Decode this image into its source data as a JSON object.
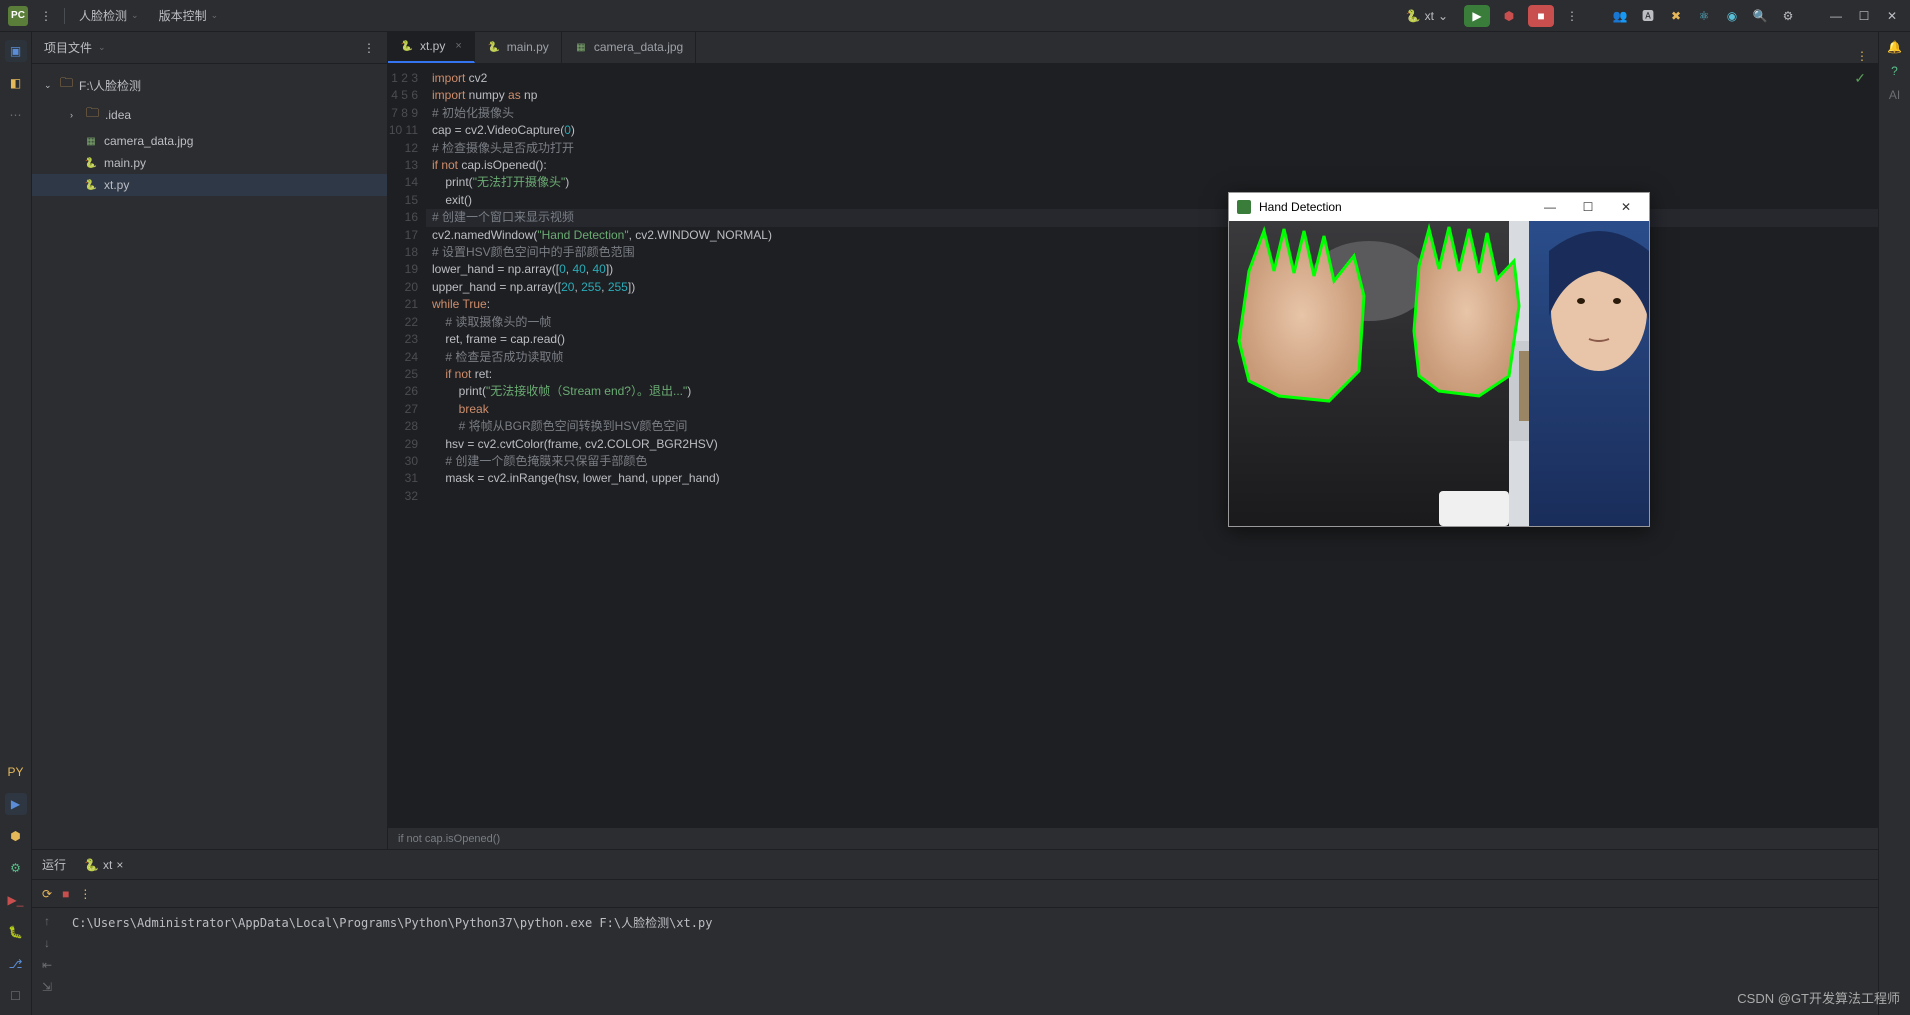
{
  "topbar": {
    "menu1": "人脸检测",
    "menu2": "版本控制",
    "runConfig": "xt"
  },
  "sidebar": {
    "title": "项目文件",
    "root": "F:\\人脸检测",
    "items": [
      {
        "name": ".idea",
        "type": "folder"
      },
      {
        "name": "camera_data.jpg",
        "type": "image"
      },
      {
        "name": "main.py",
        "type": "python"
      },
      {
        "name": "xt.py",
        "type": "python",
        "selected": true
      }
    ]
  },
  "tabs": [
    {
      "name": "xt.py",
      "type": "python",
      "active": true
    },
    {
      "name": "main.py",
      "type": "python"
    },
    {
      "name": "camera_data.jpg",
      "type": "image"
    }
  ],
  "code": {
    "lines": [
      {
        "n": 1,
        "html": "<span class='kw'>import</span> cv2"
      },
      {
        "n": 2,
        "html": "<span class='kw'>import</span> numpy <span class='kw'>as</span> np"
      },
      {
        "n": 3,
        "html": ""
      },
      {
        "n": 4,
        "html": "<span class='com'># 初始化摄像头</span>"
      },
      {
        "n": 5,
        "html": "cap = cv2.VideoCapture(<span class='num'>0</span>)"
      },
      {
        "n": 6,
        "html": ""
      },
      {
        "n": 7,
        "html": "<span class='com'># 检查摄像头是否成功打开</span>"
      },
      {
        "n": 8,
        "html": "<span class='kw'>if not</span> cap.isOpened():"
      },
      {
        "n": 9,
        "html": "    print(<span class='str'>\"无法打开摄像头\"</span>)",
        "current": true
      },
      {
        "n": 10,
        "html": "    exit()"
      },
      {
        "n": 11,
        "html": ""
      },
      {
        "n": 12,
        "html": "<span class='com'># 创建一个窗口来显示视频</span>"
      },
      {
        "n": 13,
        "html": "cv2.namedWindow(<span class='str'>\"Hand Detection\"</span>, cv2.WINDOW_NORMAL)"
      },
      {
        "n": 14,
        "html": ""
      },
      {
        "n": 15,
        "html": "<span class='com'># 设置HSV颜色空间中的手部颜色范围</span>"
      },
      {
        "n": 16,
        "html": "lower_hand = np.array([<span class='num'>0</span>, <span class='num'>40</span>, <span class='num'>40</span>])"
      },
      {
        "n": 17,
        "html": "upper_hand = np.array([<span class='num'>20</span>, <span class='num'>255</span>, <span class='num'>255</span>])"
      },
      {
        "n": 18,
        "html": ""
      },
      {
        "n": 19,
        "html": "<span class='kw'>while</span> <span class='kw'>True</span>:"
      },
      {
        "n": 20,
        "html": "    <span class='com'># 读取摄像头的一帧</span>"
      },
      {
        "n": 21,
        "html": "    ret, frame = cap.read()"
      },
      {
        "n": 22,
        "html": ""
      },
      {
        "n": 23,
        "html": "    <span class='com'># 检查是否成功读取帧</span>"
      },
      {
        "n": 24,
        "html": "    <span class='kw'>if not</span> ret:"
      },
      {
        "n": 25,
        "html": "        print(<span class='str'>\"无法接收帧（Stream end?）。退出...\"</span>)"
      },
      {
        "n": 26,
        "html": "        <span class='kw'>break</span>"
      },
      {
        "n": 27,
        "html": ""
      },
      {
        "n": 28,
        "html": "        <span class='com'># 将帧从BGR颜色空间转换到HSV颜色空间</span>"
      },
      {
        "n": 29,
        "html": "    hsv = cv2.cvtColor(frame, cv2.COLOR_BGR2HSV)"
      },
      {
        "n": 30,
        "html": ""
      },
      {
        "n": 31,
        "html": "    <span class='com'># 创建一个颜色掩膜来只保留手部颜色</span>"
      },
      {
        "n": 32,
        "html": "    mask = cv2.inRange(hsv, lower_hand, upper_hand)"
      }
    ]
  },
  "breadcrumb": "if not cap.isOpened()",
  "runPanel": {
    "tabLabel": "运行",
    "tabName": "xt",
    "console": "C:\\Users\\Administrator\\AppData\\Local\\Programs\\Python\\Python37\\python.exe F:\\人脸检测\\xt.py"
  },
  "handWindow": {
    "title": "Hand Detection"
  },
  "watermark": "CSDN @GT开发算法工程师"
}
